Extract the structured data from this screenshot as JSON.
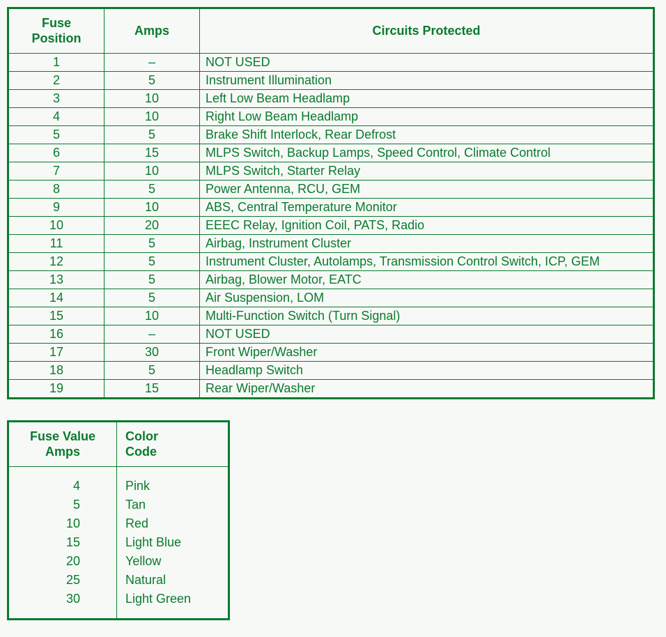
{
  "main": {
    "headers": {
      "position": "Fuse\nPosition",
      "amps": "Amps",
      "circuits": "Circuits Protected"
    },
    "rows": [
      {
        "position": "1",
        "amps": "–",
        "circuits": "NOT USED"
      },
      {
        "position": "2",
        "amps": "5",
        "circuits": "Instrument Illumination"
      },
      {
        "position": "3",
        "amps": "10",
        "circuits": "Left Low Beam Headlamp"
      },
      {
        "position": "4",
        "amps": "10",
        "circuits": "Right Low Beam Headlamp"
      },
      {
        "position": "5",
        "amps": "5",
        "circuits": "Brake Shift Interlock, Rear Defrost"
      },
      {
        "position": "6",
        "amps": "15",
        "circuits": "MLPS Switch, Backup Lamps, Speed Control, Climate Control"
      },
      {
        "position": "7",
        "amps": "10",
        "circuits": "MLPS Switch, Starter Relay"
      },
      {
        "position": "8",
        "amps": "5",
        "circuits": "Power Antenna, RCU, GEM"
      },
      {
        "position": "9",
        "amps": "10",
        "circuits": "ABS, Central Temperature Monitor"
      },
      {
        "position": "10",
        "amps": "20",
        "circuits": "EEEC Relay, Ignition Coil, PATS, Radio"
      },
      {
        "position": "11",
        "amps": "5",
        "circuits": "Airbag, Instrument Cluster"
      },
      {
        "position": "12",
        "amps": "5",
        "circuits": "Instrument Cluster, Autolamps, Transmission Control Switch, ICP, GEM"
      },
      {
        "position": "13",
        "amps": "5",
        "circuits": "Airbag, Blower Motor, EATC"
      },
      {
        "position": "14",
        "amps": "5",
        "circuits": "Air Suspension, LOM"
      },
      {
        "position": "15",
        "amps": "10",
        "circuits": "Multi-Function Switch (Turn Signal)"
      },
      {
        "position": "16",
        "amps": "–",
        "circuits": "NOT USED"
      },
      {
        "position": "17",
        "amps": "30",
        "circuits": "Front Wiper/Washer"
      },
      {
        "position": "18",
        "amps": "5",
        "circuits": "Headlamp Switch"
      },
      {
        "position": "19",
        "amps": "15",
        "circuits": "Rear Wiper/Washer"
      }
    ]
  },
  "colorTable": {
    "headers": {
      "amps": "Fuse Value\nAmps",
      "color": "Color\nCode"
    },
    "rows": [
      {
        "amps": "4",
        "color": "Pink"
      },
      {
        "amps": "5",
        "color": "Tan"
      },
      {
        "amps": "10",
        "color": "Red"
      },
      {
        "amps": "15",
        "color": "Light Blue"
      },
      {
        "amps": "20",
        "color": "Yellow"
      },
      {
        "amps": "25",
        "color": "Natural"
      },
      {
        "amps": "30",
        "color": "Light Green"
      }
    ]
  }
}
